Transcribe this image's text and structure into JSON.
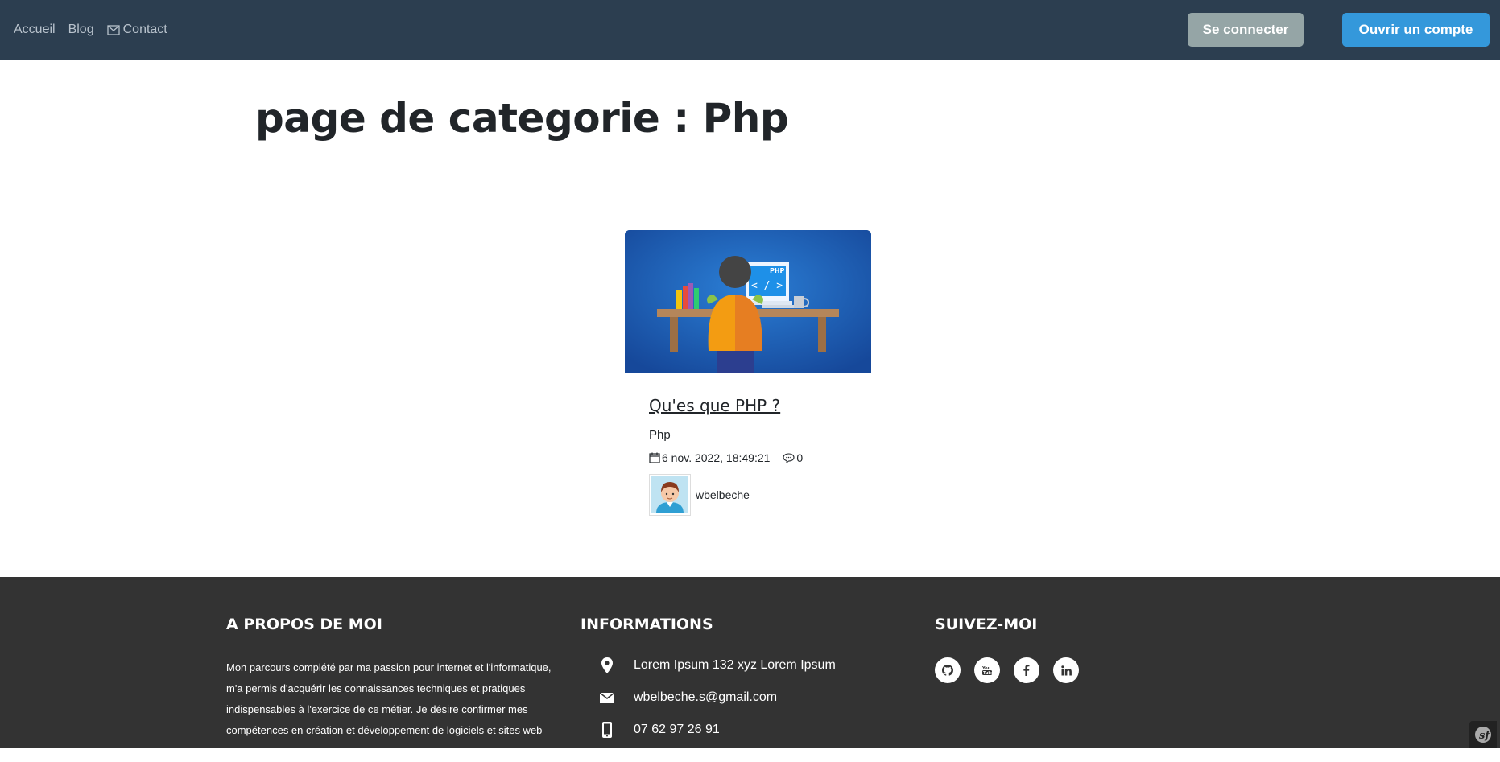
{
  "nav": {
    "links": [
      {
        "label": "Accueil"
      },
      {
        "label": "Blog"
      },
      {
        "label": "Contact",
        "icon": "envelope-icon"
      }
    ],
    "login_label": "Se connecter",
    "register_label": "Ouvrir un compte"
  },
  "page": {
    "title": "page de categorie : Php"
  },
  "article": {
    "title": "Qu'es que PHP ?",
    "category": "Php",
    "date": "6 nov. 2022, 18:49:21",
    "comments": "0",
    "author": "wbelbeche",
    "image_label": "PHP"
  },
  "footer": {
    "about": {
      "heading": "A PROPOS DE MOI",
      "lines": [
        "Mon parcours complété par ma passion pour internet et l'informatique,",
        "m'a permis d'acquérir les connaissances techniques et pratiques",
        "indispensables à l'exercice de ce métier. Je désire confirmer mes",
        "compétences en création et développement de logiciels et sites web avec"
      ]
    },
    "info": {
      "heading": "INFORMATIONS",
      "address": "Lorem Ipsum 132 xyz Lorem Ipsum",
      "email": "wbelbeche.s@gmail.com",
      "phone": "07 62 97 26 91"
    },
    "social": {
      "heading": "SUIVEZ-MOI",
      "icons": [
        "github-icon",
        "youtube-icon",
        "facebook-icon",
        "linkedin-icon"
      ]
    }
  },
  "colors": {
    "navbar": "#2c3e50",
    "login_button": "#95a5a6",
    "register_button": "#3498db",
    "footer": "#333333"
  }
}
